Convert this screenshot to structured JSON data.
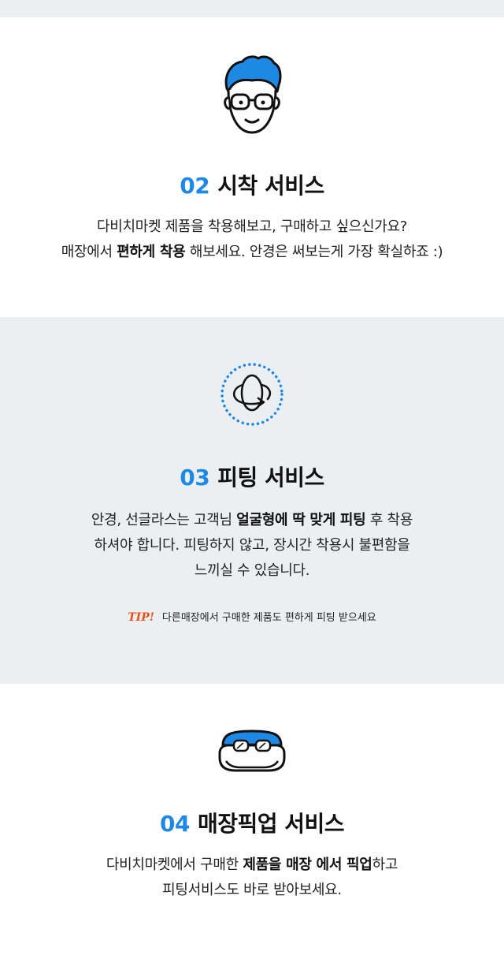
{
  "sections": {
    "s02": {
      "number": "02",
      "title": "시착 서비스",
      "line1": "다비치마켓 제품을 착용해보고, 구매하고 싶으신가요?",
      "line2_pre": "매장에서 ",
      "line2_bold": "편하게 착용",
      "line2_post": " 해보세요. 안경은 써보는게 가장 확실하죠 :)"
    },
    "s03": {
      "number": "03",
      "title": "피팅 서비스",
      "line1_pre": "안경, 선글라스는 고객님 ",
      "line1_bold": "얼굴형에 딱 맞게 피팅",
      "line1_post": " 후 착용",
      "line2": "하셔야 합니다. 피팅하지 않고, 장시간 착용시 불편함을",
      "line3": "느끼실 수 있습니다.",
      "tip_label": "TIP!",
      "tip_text": "다른매장에서 구매한 제품도 편하게 피팅 받으세요"
    },
    "s04": {
      "number": "04",
      "title": "매장픽업 서비스",
      "line1_pre": "다비치마켓에서 구매한 ",
      "line1_bold": "제품을 매장 에서 픽업",
      "line1_post": "하고",
      "line2": "피팅서비스도 바로 받아보세요."
    }
  },
  "colors": {
    "accent": "#1e88e5",
    "tip": "#e8501a",
    "gray_bg": "#eceff2"
  },
  "icons": {
    "s02": "person-glasses-icon",
    "s03": "rotate-face-icon",
    "s04": "glasses-case-icon"
  }
}
